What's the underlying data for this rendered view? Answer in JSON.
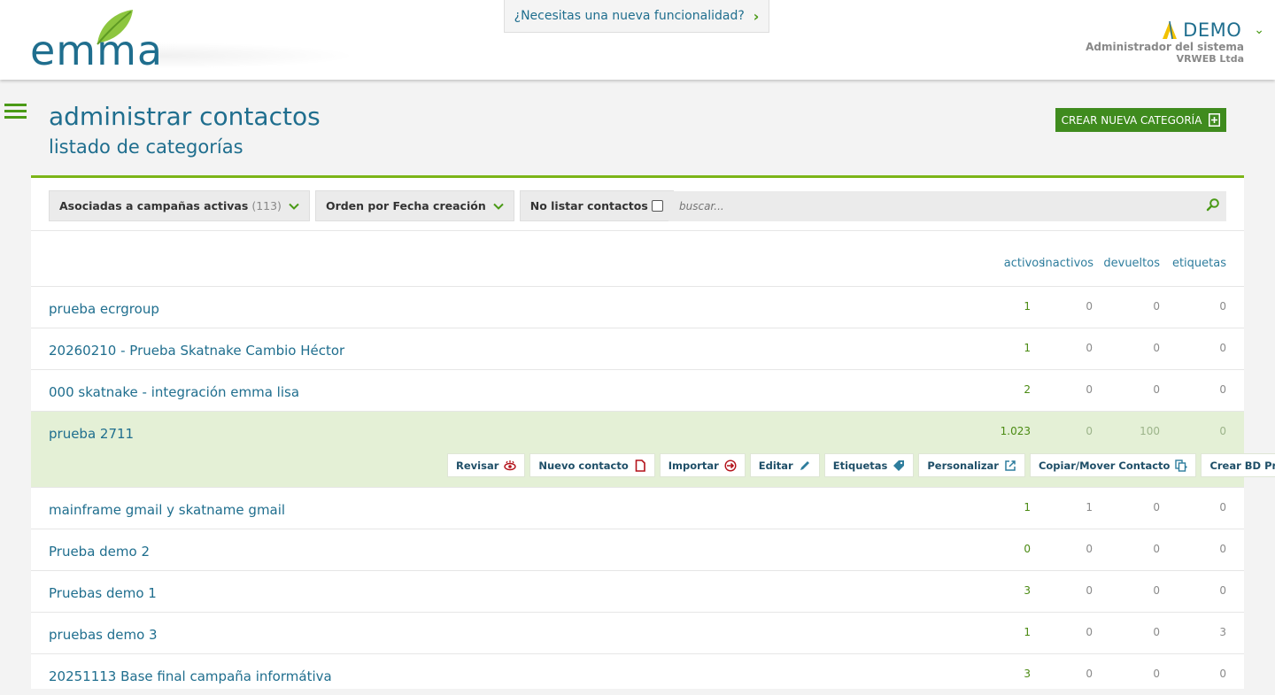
{
  "header": {
    "logo_text": "emma",
    "feature_link": "¿Necesitas una nueva funcionalidad?",
    "user": {
      "name": "DEMO",
      "role": "Administrador del sistema",
      "company": "VRWEB Ltda"
    }
  },
  "page": {
    "title": "administrar contactos",
    "subtitle": "listado de categorías",
    "create_button": "CREAR NUEVA CATEGORÍA"
  },
  "filters": {
    "campaigns_label": "Asociadas a campañas activas",
    "campaigns_count": "(113)",
    "order_label": "Orden por Fecha creación",
    "no_list_label": "No listar contactos",
    "search_placeholder": "buscar..."
  },
  "columns": [
    "activos",
    "inactivos",
    "devueltos",
    "etiquetas"
  ],
  "rows": [
    {
      "name": "prueba ecrgroup",
      "activos": "1",
      "inactivos": "0",
      "devueltos": "0",
      "etiquetas": "0"
    },
    {
      "name": "20260210 - Prueba Skatnake Cambio Héctor",
      "activos": "1",
      "inactivos": "0",
      "devueltos": "0",
      "etiquetas": "0"
    },
    {
      "name": "000 skatnake - integración emma lisa",
      "activos": "2",
      "inactivos": "0",
      "devueltos": "0",
      "etiquetas": "0"
    },
    {
      "name": "prueba 2711",
      "activos": "1.023",
      "inactivos": "0",
      "devueltos": "100",
      "etiquetas": "0"
    },
    {
      "name": "mainframe gmail y skatname gmail",
      "activos": "1",
      "inactivos": "1",
      "devueltos": "0",
      "etiquetas": "0"
    },
    {
      "name": "Prueba demo 2",
      "activos": "0",
      "inactivos": "0",
      "devueltos": "0",
      "etiquetas": "0"
    },
    {
      "name": "Pruebas demo 1",
      "activos": "3",
      "inactivos": "0",
      "devueltos": "0",
      "etiquetas": "0"
    },
    {
      "name": "pruebas demo 3",
      "activos": "1",
      "inactivos": "0",
      "devueltos": "0",
      "etiquetas": "3"
    },
    {
      "name": "20251113 Base final campaña informátiva",
      "activos": "3",
      "inactivos": "0",
      "devueltos": "0",
      "etiquetas": "0"
    }
  ],
  "row_actions": [
    "Revisar",
    "Nuevo contacto",
    "Importar",
    "Editar",
    "Etiquetas",
    "Personalizar",
    "Copiar/Mover Contacto",
    "Crear BD Pruebas"
  ],
  "colors": {
    "brand_blue": "#1f6e8e",
    "brand_green": "#3f8b1e",
    "accent_line": "#7cb518",
    "active_row_bg": "#e4f0d6"
  }
}
